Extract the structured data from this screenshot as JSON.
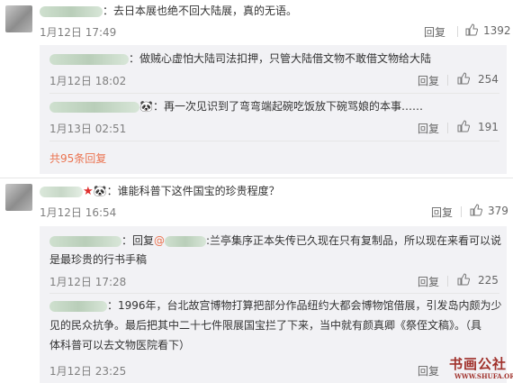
{
  "comments": [
    {
      "text": "：去日本展也绝不回大陆展，真的无语。",
      "time": "1月12日 17:49",
      "reply_label": "回复",
      "likes": "1392",
      "replies": [
        {
          "text": "：做贼心虚怕大陆司法扣押，只管大陆借文物不敢借文物给大陆",
          "time": "1月12日 18:02",
          "reply_label": "回复",
          "likes": "254"
        },
        {
          "text": "：再一次见识到了弯弯端起碗吃饭放下碗骂娘的本事……",
          "time": "1月13日 02:51",
          "reply_label": "回复",
          "likes": "191"
        }
      ],
      "more_replies": "共95条回复"
    },
    {
      "text": "：谁能科普下这件国宝的珍贵程度？",
      "time": "1月12日 16:54",
      "reply_label": "回复",
      "likes": "379",
      "replies": [
        {
          "prefix": "：回复",
          "mention": "@",
          "text": ":兰亭集序正本失传已久现在只有复制品，所以现在来看可以说",
          "text2": "是最珍贵的行书手稿",
          "time": "1月12日 17:28",
          "reply_label": "回复",
          "likes": "225"
        },
        {
          "text": "：1996年，台北故宫博物打算把部分作品纽约大都会博物馆借展，引发岛内颇为少",
          "text2": "见的民众抗争。最后把其中二十七件限展国宝拦了下来，当中就有颜真卿《祭侄文稿》。（具",
          "text3": "体科普可以去文物医院看下）",
          "time": "1月12日 23:25",
          "reply_label": "回复",
          "likes": ""
        }
      ]
    }
  ],
  "watermark": {
    "main": "书画公社",
    "sub": "WWW.SHUFA.ORG"
  }
}
